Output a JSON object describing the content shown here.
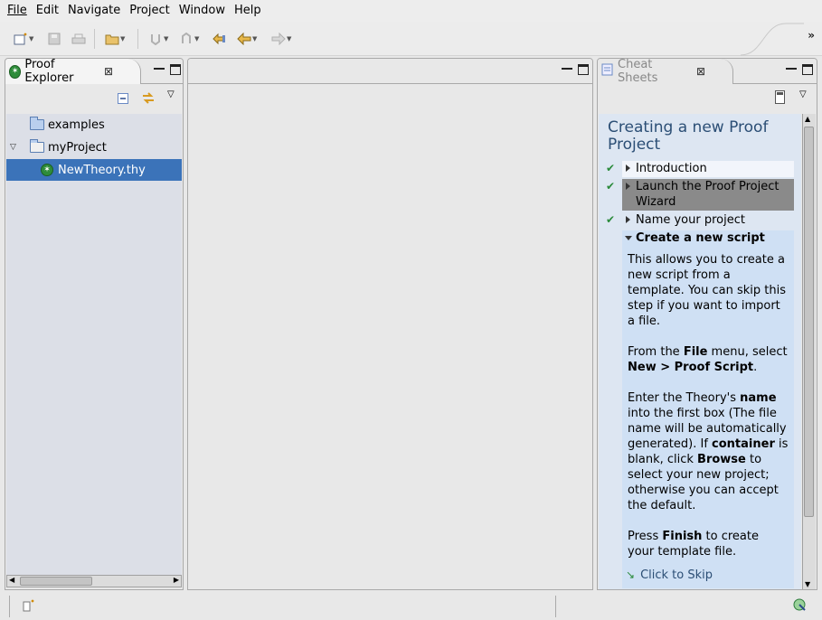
{
  "menu": [
    "File",
    "Edit",
    "Navigate",
    "Project",
    "Window",
    "Help"
  ],
  "toolbar": {
    "buttons": [
      "new-wizard-icon",
      "save-icon",
      "print-icon",
      "open-project-icon",
      "next-annotation-icon",
      "previous-annotation-icon",
      "last-edit-location-icon",
      "back-icon",
      "forward-icon"
    ],
    "overflow": "»"
  },
  "explorer": {
    "title": "Proof Explorer",
    "close": "⊠",
    "items": [
      {
        "label": "examples",
        "type": "folder"
      },
      {
        "label": "myProject",
        "type": "project"
      },
      {
        "label": "NewTheory.thy",
        "type": "file"
      }
    ]
  },
  "cheatsheet": {
    "tab_title": "Cheat Sheets",
    "close": "⊠",
    "title": "Creating a new Proof Project",
    "steps": [
      {
        "label": "Introduction",
        "done": true
      },
      {
        "label": "Launch the Proof Project Wizard",
        "done": true
      },
      {
        "label": "Name your project",
        "done": true
      },
      {
        "label": "Create a new script",
        "done": false,
        "expanded": true
      }
    ],
    "body": {
      "p1": "This allows you to create a new script from a template. You can skip this step if you want to import a file.",
      "p2_a": "From the ",
      "p2_b": "File",
      "p2_c": " menu, select ",
      "p2_d": "New > Proof Script",
      "p2_e": ".",
      "p3_a": "Enter the Theory's ",
      "p3_b": "name",
      "p3_c": " into the first box (The file name will be automatically generated). If ",
      "p3_d": "container",
      "p3_e": " is blank, click ",
      "p3_f": "Browse",
      "p3_g": " to select your new project; otherwise you can accept the default.",
      "p4_a": "Press ",
      "p4_b": "Finish",
      "p4_c": " to create your template file.",
      "skip": "Click to Skip"
    }
  },
  "colors": {
    "selection": "#3b73b9",
    "cheatsheet_bg": "#dde6f2",
    "active_step_bg": "#cfe0f4",
    "title": "#2b4e75",
    "check": "#2a8a3a"
  }
}
